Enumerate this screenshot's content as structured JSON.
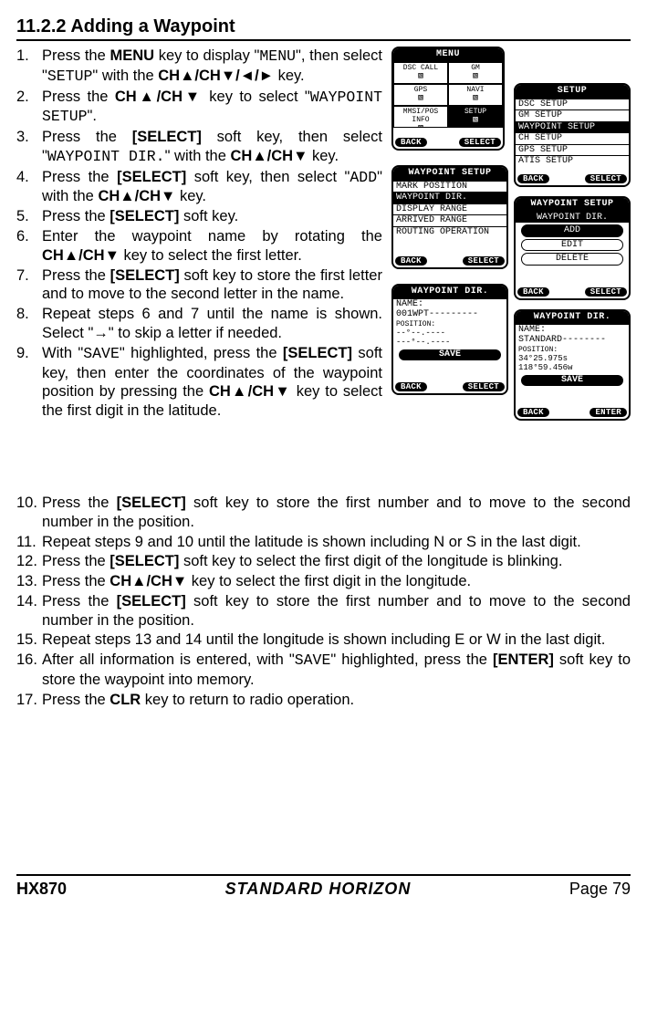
{
  "heading": "11.2.2  Adding a Waypoint",
  "steps": [
    {
      "n": "1.",
      "body": "Press the <b>MENU</b> key to display \"<span class='mono'>MENU</span>\", then select \"<span class='mono'>SETUP</span>\" with the <b>CH▲/CH▼/◄/►</b> key."
    },
    {
      "n": "2.",
      "body": "Press the <b>CH▲/CH▼</b> key to select \"<span class='mono'>WAYPOINT SETUP</span>\"."
    },
    {
      "n": "3.",
      "body": "Press the <b>[SELECT]</b> soft key, then select \"<span class='mono'>WAYPOINT DIR.</span>\" with the <b>CH▲/CH▼</b> key."
    },
    {
      "n": "4.",
      "body": "Press the <b>[SELECT]</b> soft key, then select \"<span class='mono'>ADD</span>\" with the <b>CH▲/CH▼</b> key."
    },
    {
      "n": "5.",
      "body": "Press the <b>[SELECT]</b> soft key."
    },
    {
      "n": "6.",
      "body": "Enter the waypoint name by rotating the <b>CH▲/CH▼</b> key to select the first letter."
    },
    {
      "n": "7.",
      "body": "Press the <b>[SELECT]</b> soft key to store the first letter and to move to the second letter in the name."
    },
    {
      "n": "8.",
      "body": "Repeat steps 6 and 7 until the name is shown. Select \"→\" to skip a letter if needed."
    },
    {
      "n": "9.",
      "body": "With \"<span class='mono'>SAVE</span>\" highlighted, press the <b>[SELECT]</b> soft key, then enter the coordinates of the waypoint position by pressing the <b>CH▲/CH▼</b> key to select the first digit in the latitude."
    },
    {
      "n": "10.",
      "body": "Press the <b>[SELECT]</b> soft key to store the first number and to move to the second number in the position."
    },
    {
      "n": "11.",
      "body": "Repeat steps 9 and 10 until the latitude is shown including N or S in the last digit."
    },
    {
      "n": "12.",
      "body": "Press the <b>[SELECT]</b> soft key to select the first digit of the longitude is blinking."
    },
    {
      "n": "13.",
      "body": "Press the <b>CH▲/CH▼</b> key to select the first digit in the longitude."
    },
    {
      "n": "14.",
      "body": "Press the <b>[SELECT]</b> soft key to store the first number and to move to the second number in the position."
    },
    {
      "n": "15.",
      "body": "Repeat steps 13 and 14 until the longitude is shown including E or W in the last digit."
    },
    {
      "n": "16.",
      "body": "After all information is entered, with \"<span class='mono'>SAVE</span>\" highlighted, press the <b>[ENTER]</b> soft key to store the waypoint into memory."
    },
    {
      "n": "17.",
      "body": "Press the <b>CLR</b> key to return to radio operation."
    }
  ],
  "screens": {
    "menu": {
      "title": "MENU",
      "cells": [
        "DSC CALL",
        "GM",
        "GPS",
        "NAVI",
        "MMSI/POS INFO",
        "SETUP"
      ],
      "left_sk": "BACK",
      "right_sk": "SELECT"
    },
    "setup": {
      "title": "SETUP",
      "items": [
        "DSC SETUP",
        "GM SETUP",
        "WAYPOINT SETUP",
        "CH SETUP",
        "GPS SETUP",
        "ATIS SETUP"
      ],
      "hl_index": 2,
      "left_sk": "BACK",
      "right_sk": "SELECT"
    },
    "wpsetup": {
      "title": "WAYPOINT SETUP",
      "items": [
        "MARK POSITION",
        "WAYPOINT DIR.",
        "DISPLAY RANGE",
        "ARRIVED RANGE",
        "ROUTING OPERATION"
      ],
      "hl_index": 1,
      "left_sk": "BACK",
      "right_sk": "SELECT"
    },
    "wpdir": {
      "title": "WAYPOINT SETUP",
      "subtitle": "WAYPOINT DIR.",
      "items": [
        "ADD",
        "EDIT",
        "DELETE"
      ],
      "hl_index": 0,
      "left_sk": "BACK",
      "right_sk": "SELECT"
    },
    "entry_blank": {
      "title": "WAYPOINT DIR.",
      "name_label": "NAME:",
      "name_value": " 001WPT---------",
      "pos_label": "POSITION:",
      "pos1": "   --°--.----",
      "pos2": "  ---°--.----",
      "save": "SAVE",
      "left_sk": "BACK",
      "right_sk": "SELECT"
    },
    "entry_filled": {
      "title": "WAYPOINT DIR.",
      "name_label": "NAME:",
      "name_value": " STANDARD--------",
      "pos_label": "POSITION:",
      "pos1": "    34°25.975s",
      "pos2": "   118°59.456w",
      "save": "SAVE",
      "left_sk": "BACK",
      "right_sk": "ENTER"
    }
  },
  "footer": {
    "model": "HX870",
    "brand": "STANDARD HORIZON",
    "page": "Page 79"
  }
}
